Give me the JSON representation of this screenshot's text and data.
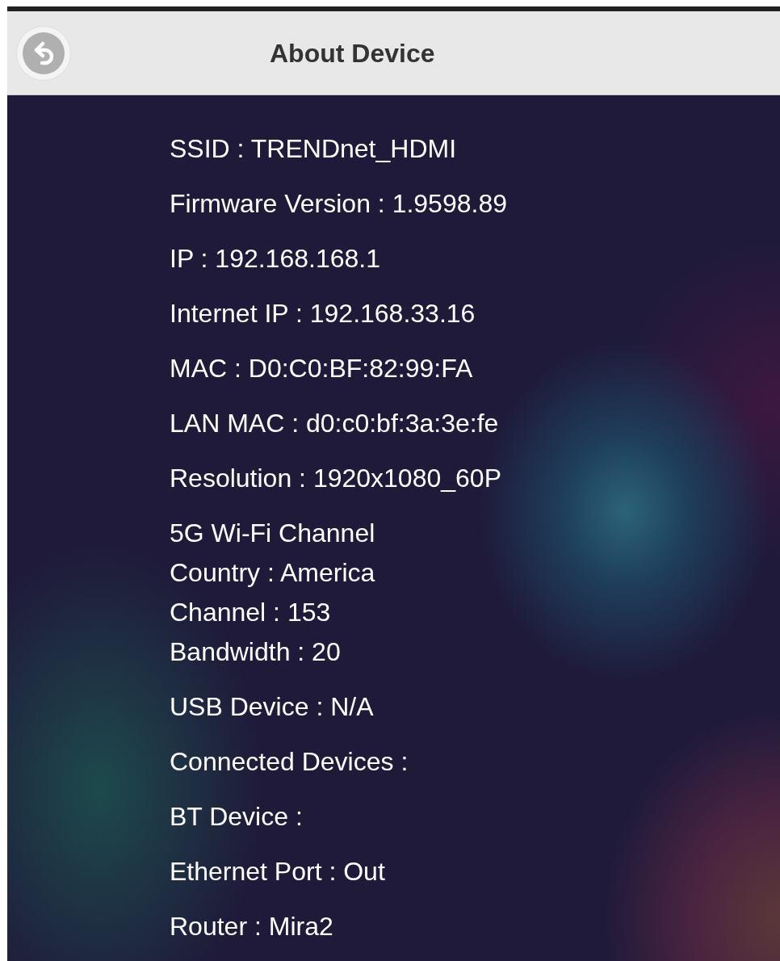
{
  "header": {
    "title": "About Device"
  },
  "info": [
    {
      "lines": [
        "SSID : TRENDnet_HDMI"
      ]
    },
    {
      "lines": [
        "Firmware Version : 1.9598.89"
      ]
    },
    {
      "lines": [
        "IP : 192.168.168.1"
      ]
    },
    {
      "lines": [
        "Internet IP : 192.168.33.16"
      ]
    },
    {
      "lines": [
        "MAC : D0:C0:BF:82:99:FA"
      ]
    },
    {
      "lines": [
        "LAN MAC : d0:c0:bf:3a:3e:fe"
      ]
    },
    {
      "lines": [
        "Resolution : 1920x1080_60P"
      ]
    },
    {
      "lines": [
        "5G Wi-Fi Channel",
        "Country : America",
        "Channel : 153",
        "Bandwidth : 20"
      ]
    },
    {
      "lines": [
        "USB Device : N/A"
      ]
    },
    {
      "lines": [
        "Connected Devices :"
      ]
    },
    {
      "lines": [
        "BT Device :"
      ]
    },
    {
      "lines": [
        "Ethernet Port : Out"
      ]
    },
    {
      "lines": [
        "Router : Mira2"
      ]
    }
  ]
}
